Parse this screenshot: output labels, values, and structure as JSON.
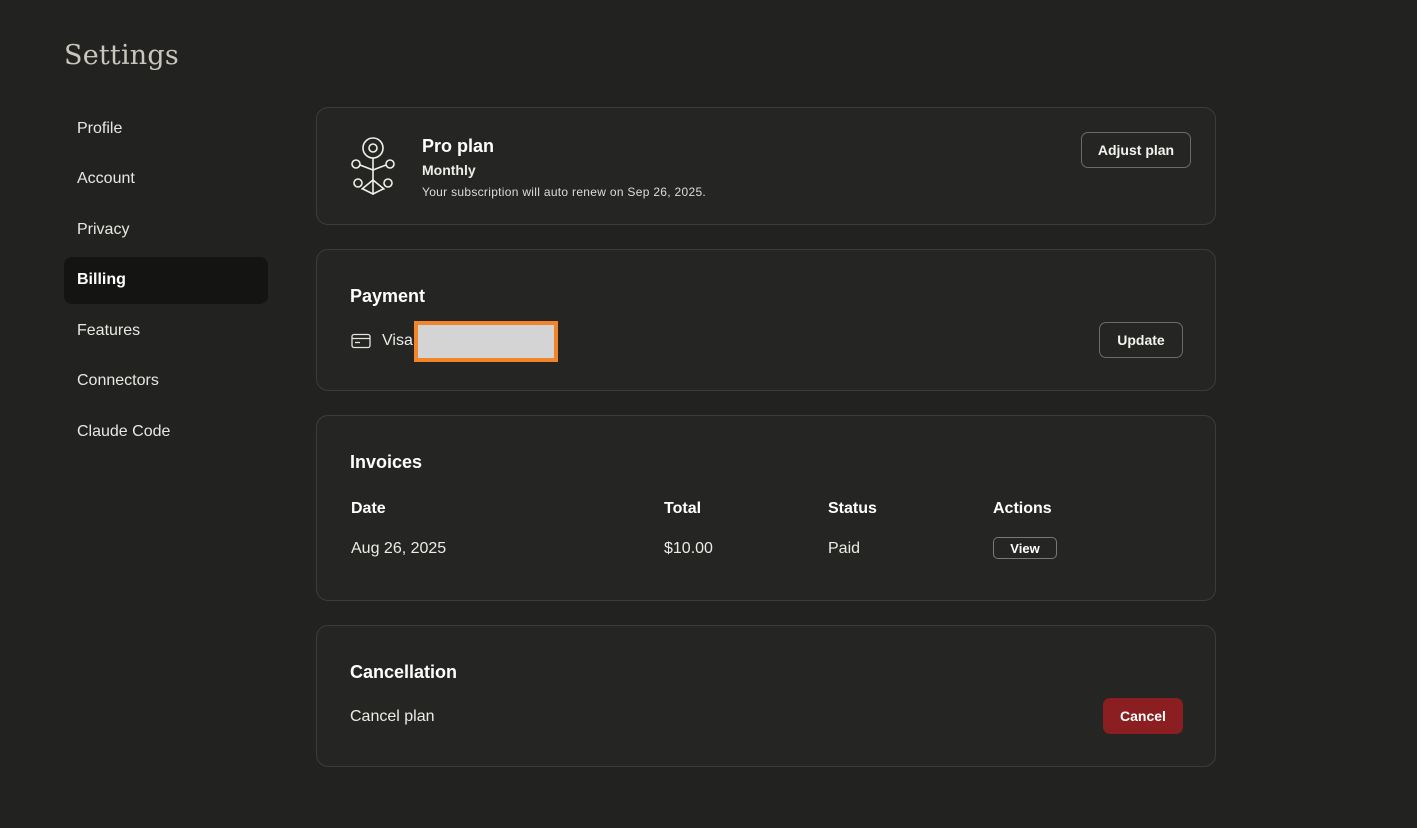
{
  "page": {
    "title": "Settings"
  },
  "sidebar": {
    "items": [
      {
        "label": "Profile",
        "active": false
      },
      {
        "label": "Account",
        "active": false
      },
      {
        "label": "Privacy",
        "active": false
      },
      {
        "label": "Billing",
        "active": true
      },
      {
        "label": "Features",
        "active": false
      },
      {
        "label": "Connectors",
        "active": false
      },
      {
        "label": "Claude Code",
        "active": false
      }
    ]
  },
  "plan": {
    "icon": "plan-emblem-icon",
    "name": "Pro plan",
    "cycle": "Monthly",
    "renewal_text": "Your subscription will auto renew on Sep 26, 2025.",
    "adjust_label": "Adjust plan"
  },
  "payment": {
    "title": "Payment",
    "card_icon": "credit-card-icon",
    "card_brand": "Visa",
    "update_label": "Update"
  },
  "invoices": {
    "title": "Invoices",
    "columns": [
      "Date",
      "Total",
      "Status",
      "Actions"
    ],
    "rows": [
      {
        "date": "Aug 26, 2025",
        "total": "$10.00",
        "status": "Paid",
        "action": "View"
      }
    ]
  },
  "cancellation": {
    "title": "Cancellation",
    "label": "Cancel plan",
    "button_label": "Cancel",
    "button_color": "#8b1e20"
  },
  "colors": {
    "background": "#222220",
    "card_border": "#3d3c38",
    "redaction_border": "#f2852a"
  }
}
